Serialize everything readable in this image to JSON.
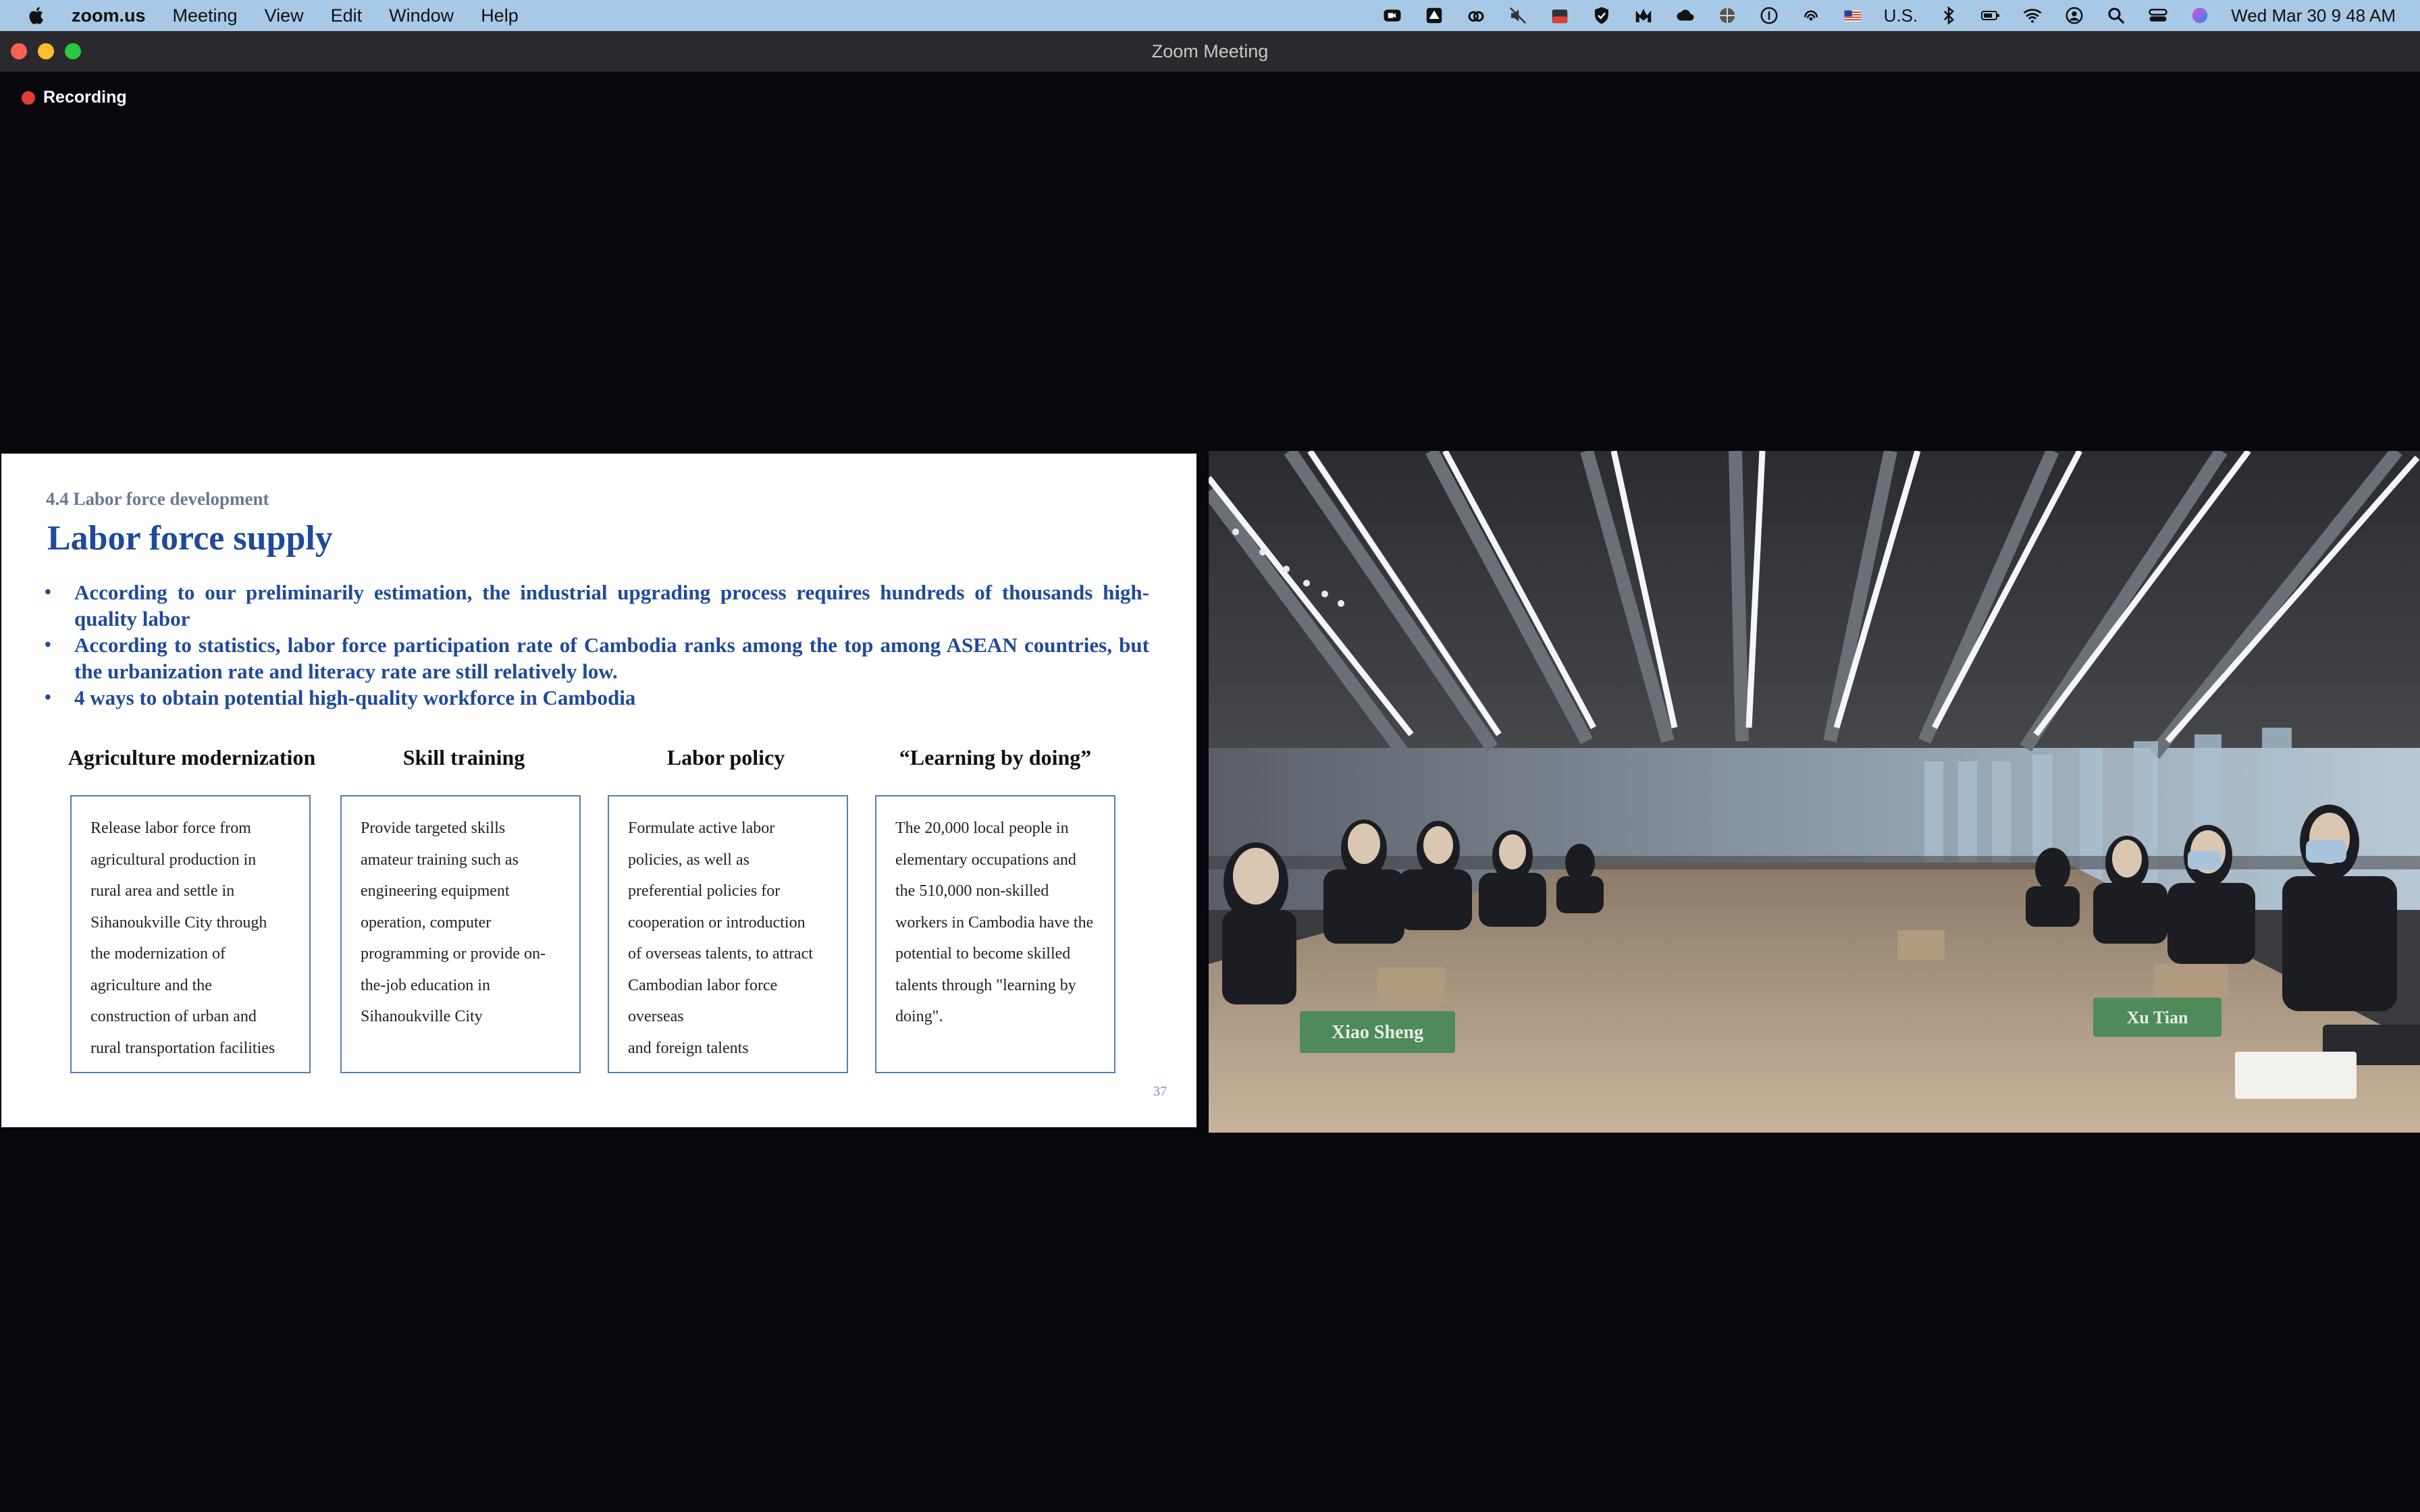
{
  "menubar": {
    "app_name": "zoom.us",
    "items": [
      "Meeting",
      "View",
      "Edit",
      "Window",
      "Help"
    ],
    "input_source": "U.S.",
    "clock": "Wed Mar 30  9 48 AM",
    "tray_icons": [
      "zoom-video-icon",
      "drive-icon",
      "creative-cloud-icon",
      "mute-icon",
      "calendar-badge-icon",
      "shield-check-icon",
      "malwarebytes-icon",
      "cloud-icon",
      "globe-icon",
      "accessibility-icon",
      "airdrop-icon",
      "flag-icon",
      "bluetooth-icon",
      "battery-icon",
      "wifi-icon",
      "user-icon",
      "search-icon",
      "control-center-icon",
      "siri-icon"
    ]
  },
  "window": {
    "title": "Zoom Meeting",
    "recording_label": "Recording"
  },
  "slide": {
    "section": "4.4 Labor force development",
    "title": "Labor force supply",
    "bullets": [
      "According to our preliminarily estimation, the industrial upgrading process requires hundreds of thousands high-quality labor",
      "According to statistics, labor force participation rate of Cambodia ranks among the top among ASEAN countries, but the urbanization rate and literacy rate are still relatively low.",
      "4 ways to obtain potential high-quality workforce in Cambodia"
    ],
    "columns": [
      {
        "heading": "Agriculture modernization",
        "lines": [
          "Release labor force from",
          "agricultural production in",
          "rural area and settle in",
          "Sihanoukville City through",
          "the modernization of",
          "agriculture and the",
          "construction of urban and",
          "rural transportation facilities"
        ]
      },
      {
        "heading": "Skill training",
        "lines": [
          "Provide targeted skills",
          "amateur training such as",
          "engineering equipment",
          "operation, computer",
          "programming or provide on-",
          "the-job education in",
          "Sihanoukville City"
        ]
      },
      {
        "heading": "Labor policy",
        "lines": [
          "Formulate active labor",
          "policies, as well as",
          "preferential policies for",
          "cooperation or introduction",
          "of overseas talents, to attract",
          "Cambodian labor force",
          "overseas",
          "and foreign talents"
        ]
      },
      {
        "heading": "“Learning by doing”",
        "lines": [
          "The 20,000 local people in",
          "elementary occupations and",
          "the 510,000 non-skilled",
          "workers in Cambodia have the",
          "potential to become skilled",
          "talents through \"learning by",
          "doing\"."
        ]
      }
    ],
    "page_number": "37"
  },
  "video": {
    "name_cards": [
      "Xiao Sheng",
      "Xu Tian"
    ]
  },
  "colors": {
    "menubar_bg": "#a8c9e6",
    "slide_accent": "#1f4a9a",
    "recording_dot": "#e23b3b"
  }
}
